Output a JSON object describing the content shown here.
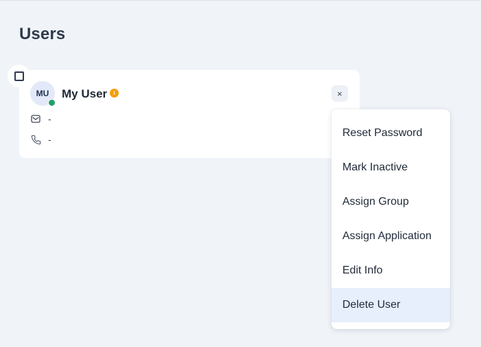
{
  "page": {
    "title": "Users"
  },
  "user_card": {
    "initials": "MU",
    "name": "My User",
    "info_badge": "i",
    "close_symbol": "×",
    "email": "-",
    "phone": "-",
    "status": "online",
    "status_color": "#22a06b",
    "info_color": "#f59e0b"
  },
  "menu": {
    "items": [
      {
        "label": "Reset Password"
      },
      {
        "label": "Mark Inactive"
      },
      {
        "label": "Assign Group"
      },
      {
        "label": "Assign Application"
      },
      {
        "label": "Edit Info"
      },
      {
        "label": "Delete User"
      }
    ],
    "highlighted": "Delete User",
    "highlight_color": "#e7eefc"
  },
  "icons": {
    "select": "checkbox-icon",
    "email": "mail-icon",
    "phone": "phone-icon",
    "info": "info-icon",
    "close": "close-icon"
  }
}
